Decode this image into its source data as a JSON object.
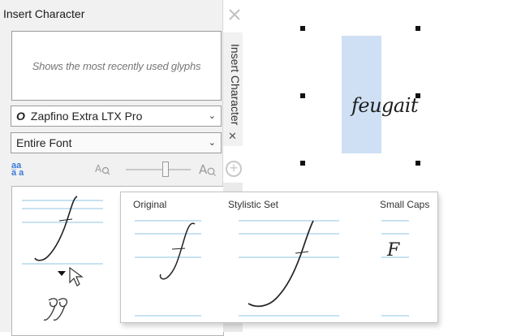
{
  "panel": {
    "title": "Insert Character",
    "recent_placeholder": "Shows the most recently used glyphs",
    "font_name": "Zapfino Extra LTX Pro",
    "range": "Entire Font",
    "vertical_tab_label": "Insert Character"
  },
  "flyout": {
    "original_label": "Original",
    "stylistic_label": "Stylistic Set",
    "smallcaps_label": "Small Caps",
    "smallcaps_glyph": "F"
  },
  "canvas": {
    "word": "feugait"
  },
  "colors": {
    "panel_bg": "#f1f1f1",
    "guide_blue": "#8fc4e3",
    "selection_fill": "#cfe0f4",
    "accent": "#3a7bd5"
  },
  "icons": {
    "close": "close-icon",
    "font": "font-type-icon",
    "dropdown": "chevron-down-icon",
    "case": "aa-case-icon",
    "zoom_out": "zoom-out-icon",
    "zoom_in": "zoom-in-icon",
    "add": "plus-circle-icon",
    "cursor": "pointer-cursor-icon"
  }
}
